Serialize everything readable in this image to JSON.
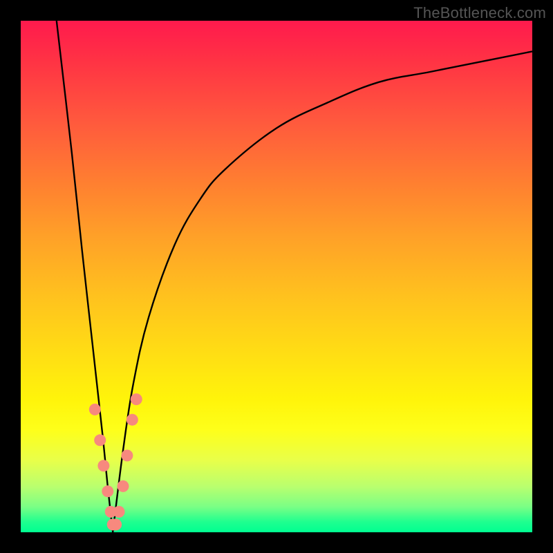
{
  "watermark": "TheBottleneck.com",
  "colors": {
    "curve_stroke": "#000000",
    "marker_fill": "#f7897e",
    "gradient_top": "#ff1a4d",
    "gradient_bottom": "#00ff91",
    "frame_bg": "#000000"
  },
  "chart_data": {
    "type": "line",
    "title": "",
    "xlabel": "",
    "ylabel": "",
    "xlim": [
      0,
      100
    ],
    "ylim": [
      0,
      100
    ],
    "grid": false,
    "note": "No axis ticks or numeric labels are visible in the image; numeric values below are estimated from pixel positions on a 0-100 normalized scale (x left→right, y bottom→top).",
    "series": [
      {
        "name": "left-branch",
        "x": [
          7,
          10,
          12,
          14,
          16,
          17,
          18
        ],
        "y": [
          100,
          74,
          55,
          37,
          19,
          9,
          0
        ]
      },
      {
        "name": "right-branch",
        "x": [
          18,
          20,
          22,
          25,
          30,
          35,
          40,
          50,
          60,
          70,
          80,
          90,
          100
        ],
        "y": [
          0,
          16,
          29,
          42,
          56,
          65,
          71,
          79,
          84,
          88,
          90,
          92,
          94
        ]
      }
    ],
    "markers": {
      "name": "highlighted-points",
      "points": [
        {
          "x": 14.5,
          "y": 24
        },
        {
          "x": 15.5,
          "y": 18
        },
        {
          "x": 16.2,
          "y": 13
        },
        {
          "x": 17.0,
          "y": 8
        },
        {
          "x": 17.6,
          "y": 4
        },
        {
          "x": 18.0,
          "y": 1.5
        },
        {
          "x": 18.6,
          "y": 1.5
        },
        {
          "x": 19.2,
          "y": 4
        },
        {
          "x": 20.0,
          "y": 9
        },
        {
          "x": 20.8,
          "y": 15
        },
        {
          "x": 21.8,
          "y": 22
        },
        {
          "x": 22.6,
          "y": 26
        }
      ]
    }
  }
}
